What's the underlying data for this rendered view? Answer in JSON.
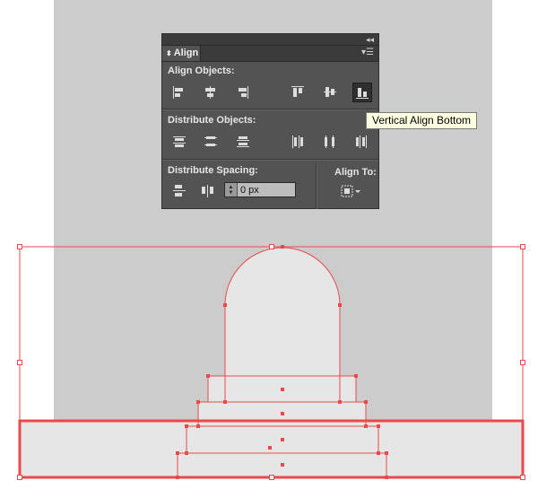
{
  "panel": {
    "tab_label": "Align",
    "sections": {
      "align_objects": "Align Objects:",
      "distribute_objects": "Distribute Objects:",
      "distribute_spacing": "Distribute Spacing:",
      "align_to": "Align To:"
    },
    "spacing_value": "0 px",
    "icons": {
      "align_objects": [
        "horizontal-align-left-icon",
        "horizontal-align-center-icon",
        "horizontal-align-right-icon",
        "vertical-align-top-icon",
        "vertical-align-center-icon",
        "vertical-align-bottom-icon"
      ],
      "distribute_objects": [
        "vertical-distribute-top-icon",
        "vertical-distribute-center-icon",
        "vertical-distribute-bottom-icon",
        "horizontal-distribute-left-icon",
        "horizontal-distribute-center-icon",
        "horizontal-distribute-right-icon"
      ],
      "distribute_spacing": [
        "vertical-distribute-space-icon",
        "horizontal-distribute-space-icon"
      ],
      "align_to": "align-to-selection-icon"
    },
    "active_button": "vertical-align-bottom"
  },
  "tooltip": {
    "text": "Vertical Align Bottom"
  },
  "colors": {
    "panel_bg": "#535353",
    "artboard_bg": "#cccccc",
    "selection": "#e84a4a",
    "shape_fill": "#e6e6e6"
  }
}
